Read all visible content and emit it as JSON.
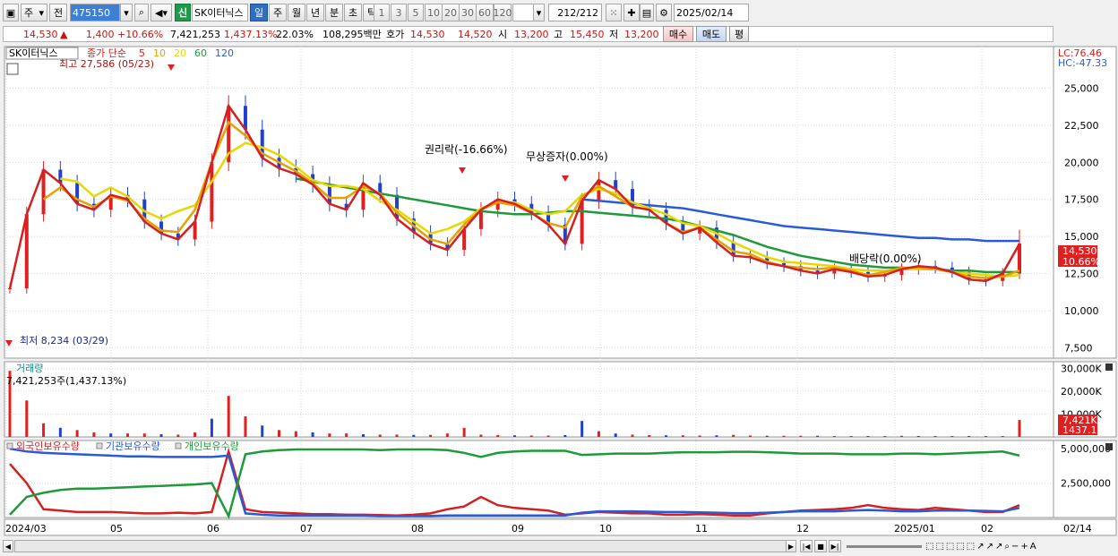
{
  "toolbar": {
    "market": "주",
    "prev_label": "전",
    "code": "475150",
    "name": "SK이터닉스",
    "periods": [
      "일",
      "주",
      "월",
      "년",
      "분",
      "초",
      "틱"
    ],
    "active_period": "일",
    "intervals": [
      "1",
      "3",
      "5",
      "10",
      "20",
      "30",
      "60",
      "120"
    ],
    "count": "212",
    "count_total": "/212",
    "date": "2025/02/14",
    "new_label": "신"
  },
  "quote": {
    "price": "14,530",
    "change_arrow": "▲",
    "change": "1,400",
    "change_pct": "+10.66%",
    "volume": "7,421,253",
    "volume_pct": "1,437.13%",
    "turnover": "22.03%",
    "amount": "108,295백만",
    "hoga_label": "호가",
    "ask": "14,530",
    "bid": "14,520",
    "open_label": "시",
    "open": "13,200",
    "high_label": "고",
    "high": "15,450",
    "low_label": "저",
    "low": "13,200",
    "buy_label": "매수",
    "sell_label": "매도",
    "eval_label": "평"
  },
  "price_panel": {
    "title": "SK이터닉스",
    "ma_label": "종가 단순",
    "ma_periods": [
      "5",
      "10",
      "20",
      "60",
      "120"
    ],
    "ma_colors": [
      "#d42020",
      "#e8a000",
      "#e6d800",
      "#1e9a3a",
      "#2a5ad8"
    ],
    "high_note": "최고 27,586 (05/23)",
    "low_note": "최저 8,234 (03/29)",
    "annotations": [
      "권리락(-16.66%)",
      "무상증자(0.00%)",
      "배당락(0.00%)"
    ],
    "lc": "LC:76.46",
    "hc": "HC:-47.33",
    "price_tag": "14,530",
    "pct_tag": "10.66%"
  },
  "volume_panel": {
    "title": "거래량",
    "subtitle": "7,421,253주(1,437.13%)",
    "tag1": "7,421K",
    "tag2": "1437.13%"
  },
  "holders_panel": {
    "series": [
      "외국인보유수량",
      "기관보유수량",
      "개인보유수량"
    ],
    "colors": [
      "#d42020",
      "#2a5ad8",
      "#1e9a3a"
    ]
  },
  "chart_data": [
    {
      "type": "candlestick",
      "title": "SK이터닉스",
      "x_labels": [
        "2024/03",
        "05",
        "06",
        "07",
        "08",
        "09",
        "10",
        "11",
        "12",
        "2025/01",
        "02",
        "02/14"
      ],
      "y_ticks": [
        7500,
        10000,
        12500,
        15000,
        17500,
        20000,
        22500,
        25000
      ],
      "ylim": [
        6800,
        27800
      ],
      "ma_series": [
        {
          "name": "5",
          "values": [
            11500,
            16500,
            19500,
            18600,
            17200,
            16800,
            17800,
            17500,
            16000,
            15200,
            14800,
            16000,
            20000,
            23800,
            22200,
            20300,
            19600,
            19200,
            18500,
            17200,
            16800,
            18600,
            17800,
            16200,
            15300,
            14500,
            14100,
            15500,
            16800,
            17500,
            17200,
            16600,
            15800,
            14500,
            17400,
            18800,
            18200,
            17000,
            16800,
            15900,
            15200,
            15600,
            14600,
            13700,
            13600,
            13200,
            13000,
            12700,
            12500,
            12800,
            12600,
            12300,
            12400,
            12800,
            13000,
            12900,
            12600,
            12100,
            12000,
            12500,
            14500
          ]
        },
        {
          "name": "10",
          "values": [
            null,
            null,
            17500,
            18300,
            17500,
            17000,
            17700,
            17400,
            16200,
            15400,
            15300,
            16800,
            20000,
            22700,
            21800,
            20600,
            20000,
            19400,
            18600,
            17600,
            17600,
            18400,
            17900,
            16600,
            15700,
            14800,
            14500,
            15800,
            16800,
            17300,
            17100,
            16600,
            15900,
            15600,
            17700,
            18400,
            17700,
            17000,
            16800,
            15900,
            15300,
            15600,
            14800,
            14000,
            13800,
            13300,
            13000,
            12900,
            12800,
            12900,
            12700,
            12400,
            12600,
            12900,
            12900,
            12800,
            12600,
            12300,
            12200,
            12300,
            12700
          ]
        },
        {
          "name": "20",
          "values": [
            null,
            null,
            null,
            18900,
            18700,
            17700,
            18300,
            17700,
            16700,
            16200,
            16700,
            17100,
            18700,
            20600,
            21300,
            21000,
            20500,
            19700,
            18800,
            18400,
            18400,
            18200,
            17400,
            16800,
            16000,
            15200,
            15500,
            16000,
            16900,
            17300,
            17300,
            16800,
            16500,
            16700,
            17800,
            18200,
            17900,
            17300,
            16900,
            16500,
            15900,
            15700,
            15200,
            14600,
            14100,
            13600,
            13300,
            13200,
            13100,
            13000,
            12800,
            12700,
            12700,
            12800,
            12800,
            12800,
            12600,
            12500,
            12400,
            12300,
            12400
          ]
        },
        {
          "name": "60",
          "values": [
            null,
            null,
            null,
            null,
            null,
            null,
            null,
            null,
            null,
            null,
            null,
            null,
            null,
            null,
            null,
            null,
            null,
            18900,
            18700,
            18500,
            18300,
            18100,
            17900,
            17700,
            17500,
            17300,
            17100,
            16900,
            16700,
            16600,
            16500,
            16500,
            16600,
            16700,
            16700,
            16600,
            16500,
            16400,
            16300,
            16200,
            16000,
            15700,
            15400,
            15100,
            14700,
            14300,
            14000,
            13700,
            13500,
            13300,
            13100,
            13000,
            12900,
            12900,
            12800,
            12800,
            12700,
            12700,
            12600,
            12600,
            12600
          ]
        },
        {
          "name": "120",
          "values": [
            null,
            null,
            null,
            null,
            null,
            null,
            null,
            null,
            null,
            null,
            null,
            null,
            null,
            null,
            null,
            null,
            null,
            null,
            null,
            null,
            null,
            null,
            null,
            null,
            null,
            null,
            null,
            null,
            null,
            null,
            null,
            null,
            null,
            null,
            17500,
            17400,
            17300,
            17200,
            17100,
            17000,
            16900,
            16700,
            16500,
            16300,
            16100,
            15900,
            15700,
            15600,
            15500,
            15400,
            15300,
            15200,
            15100,
            15000,
            14900,
            14900,
            14800,
            14800,
            14700,
            14700,
            14700
          ]
        }
      ],
      "last": {
        "open": 13200,
        "high": 15450,
        "low": 13200,
        "close": 14530
      }
    },
    {
      "type": "bar",
      "title": "거래량",
      "y_ticks_label": [
        "10,000K",
        "20,000K",
        "30,000K"
      ],
      "y_ticks": [
        10000,
        20000,
        30000
      ],
      "ylim": [
        0,
        33000
      ],
      "values": [
        29000,
        16000,
        6000,
        4000,
        3000,
        2000,
        1500,
        1500,
        1500,
        1200,
        1000,
        2000,
        8000,
        18000,
        9000,
        5000,
        3000,
        2500,
        2000,
        1500,
        1500,
        1200,
        1000,
        1000,
        900,
        900,
        1500,
        4000,
        1000,
        800,
        700,
        600,
        600,
        800,
        7000,
        2500,
        1500,
        1000,
        800,
        700,
        700,
        600,
        700,
        900,
        600,
        500,
        500,
        500,
        500,
        400,
        400,
        400,
        400,
        500,
        400,
        400,
        400,
        400,
        400,
        400,
        7421
      ]
    },
    {
      "type": "line",
      "title": "보유수량",
      "y_ticks_label": [
        "2,500,000",
        "5,000,000"
      ],
      "y_ticks": [
        2500000,
        5000000
      ],
      "ylim": [
        0,
        5600000
      ],
      "series": [
        {
          "name": "외국인보유수량",
          "values": [
            3900000,
            2500000,
            600000,
            500000,
            400000,
            400000,
            400000,
            350000,
            300000,
            300000,
            350000,
            300000,
            400000,
            4800000,
            600000,
            400000,
            350000,
            300000,
            250000,
            250000,
            200000,
            200000,
            180000,
            150000,
            200000,
            300000,
            600000,
            800000,
            1500000,
            900000,
            700000,
            600000,
            500000,
            200000,
            300000,
            400000,
            350000,
            300000,
            300000,
            200000,
            200000,
            250000,
            200000,
            150000,
            150000,
            300000,
            400000,
            500000,
            550000,
            600000,
            700000,
            900000,
            700000,
            600000,
            550000,
            700000,
            600000,
            500000,
            400000,
            400000,
            900000
          ]
        },
        {
          "name": "기관보유수량",
          "values": [
            5000000,
            4800000,
            4700000,
            4650000,
            4600000,
            4550000,
            4500000,
            4450000,
            4450000,
            4400000,
            4400000,
            4400000,
            4400000,
            4500000,
            300000,
            200000,
            150000,
            150000,
            150000,
            150000,
            150000,
            150000,
            120000,
            120000,
            120000,
            120000,
            150000,
            150000,
            150000,
            150000,
            150000,
            150000,
            150000,
            150000,
            350000,
            450000,
            450000,
            450000,
            420000,
            400000,
            400000,
            380000,
            350000,
            320000,
            320000,
            350000,
            400000,
            450000,
            450000,
            450000,
            500000,
            550000,
            500000,
            450000,
            450000,
            500000,
            500000,
            500000,
            480000,
            450000,
            700000
          ]
        },
        {
          "name": "개인보유수량",
          "values": [
            200000,
            1500000,
            1800000,
            2000000,
            2100000,
            2100000,
            2150000,
            2200000,
            2250000,
            2300000,
            2350000,
            2400000,
            2500000,
            100000,
            4600000,
            4800000,
            4900000,
            4950000,
            4950000,
            4950000,
            4950000,
            4950000,
            4900000,
            4950000,
            4950000,
            4950000,
            4900000,
            4700000,
            4400000,
            4700000,
            4800000,
            4850000,
            4850000,
            4850000,
            4550000,
            4600000,
            4650000,
            4650000,
            4650000,
            4700000,
            4750000,
            4750000,
            4750000,
            4780000,
            4780000,
            4750000,
            4700000,
            4650000,
            4650000,
            4650000,
            4600000,
            4600000,
            4600000,
            4650000,
            4650000,
            4600000,
            4650000,
            4700000,
            4750000,
            4800000,
            4500000
          ]
        }
      ]
    }
  ]
}
